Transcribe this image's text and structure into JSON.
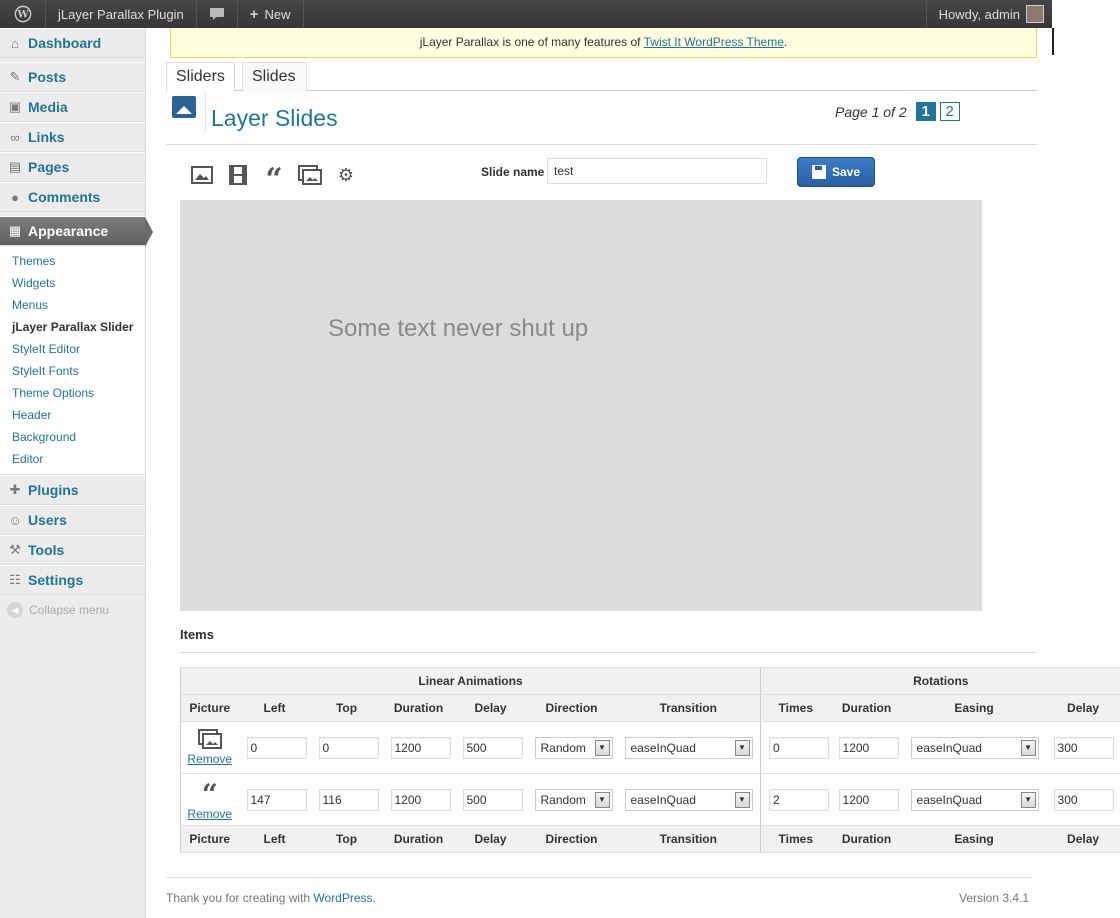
{
  "adminbar": {
    "site_name": "jLayer Parallax Plugin",
    "new_label": "New",
    "howdy": "Howdy, admin"
  },
  "sidebar": {
    "dashboard": "Dashboard",
    "posts": "Posts",
    "media": "Media",
    "links": "Links",
    "pages": "Pages",
    "comments": "Comments",
    "appearance": "Appearance",
    "submenu": [
      "Themes",
      "Widgets",
      "Menus",
      "jLayer Parallax Slider",
      "StyleIt Editor",
      "StyleIt Fonts",
      "Theme Options",
      "Header",
      "Background",
      "Editor"
    ],
    "plugins": "Plugins",
    "users": "Users",
    "tools": "Tools",
    "settings": "Settings",
    "collapse": "Collapse menu"
  },
  "notice": {
    "text_before": "jLayer Parallax is one of many features of ",
    "link": "Twist It WordPress Theme",
    "text_after": "."
  },
  "tabs": [
    "Sliders",
    "Slides"
  ],
  "header": {
    "title": "Layer Slides",
    "pager_text": "Page 1 of 2",
    "pages": [
      "1",
      "2"
    ]
  },
  "editor": {
    "slide_name_label": "Slide name",
    "slide_name_value": "test",
    "save_label": "Save",
    "canvas_text": "Some text never shut up"
  },
  "items": {
    "label": "Items",
    "group_linear": "Linear Animations",
    "group_rotations": "Rotations",
    "columns": [
      "Picture",
      "Left",
      "Top",
      "Duration",
      "Delay",
      "Direction",
      "Transition",
      "Times",
      "Duration",
      "Easing",
      "Delay"
    ],
    "remove_label": "Remove",
    "rows": [
      {
        "left": "0",
        "top": "0",
        "duration": "1200",
        "delay": "500",
        "direction": "Random",
        "transition": "easeInQuad",
        "times": "0",
        "rot_duration": "1200",
        "easing": "easeInQuad",
        "rot_delay": "300"
      },
      {
        "left": "147",
        "top": "116",
        "duration": "1200",
        "delay": "500",
        "direction": "Random",
        "transition": "easeInQuad",
        "times": "2",
        "rot_duration": "1200",
        "easing": "easeInQuad",
        "rot_delay": "300"
      }
    ]
  },
  "footer": {
    "thanks_before": "Thank you for creating with ",
    "thanks_link": "WordPress",
    "thanks_after": ".",
    "version": "Version 3.4.1"
  }
}
